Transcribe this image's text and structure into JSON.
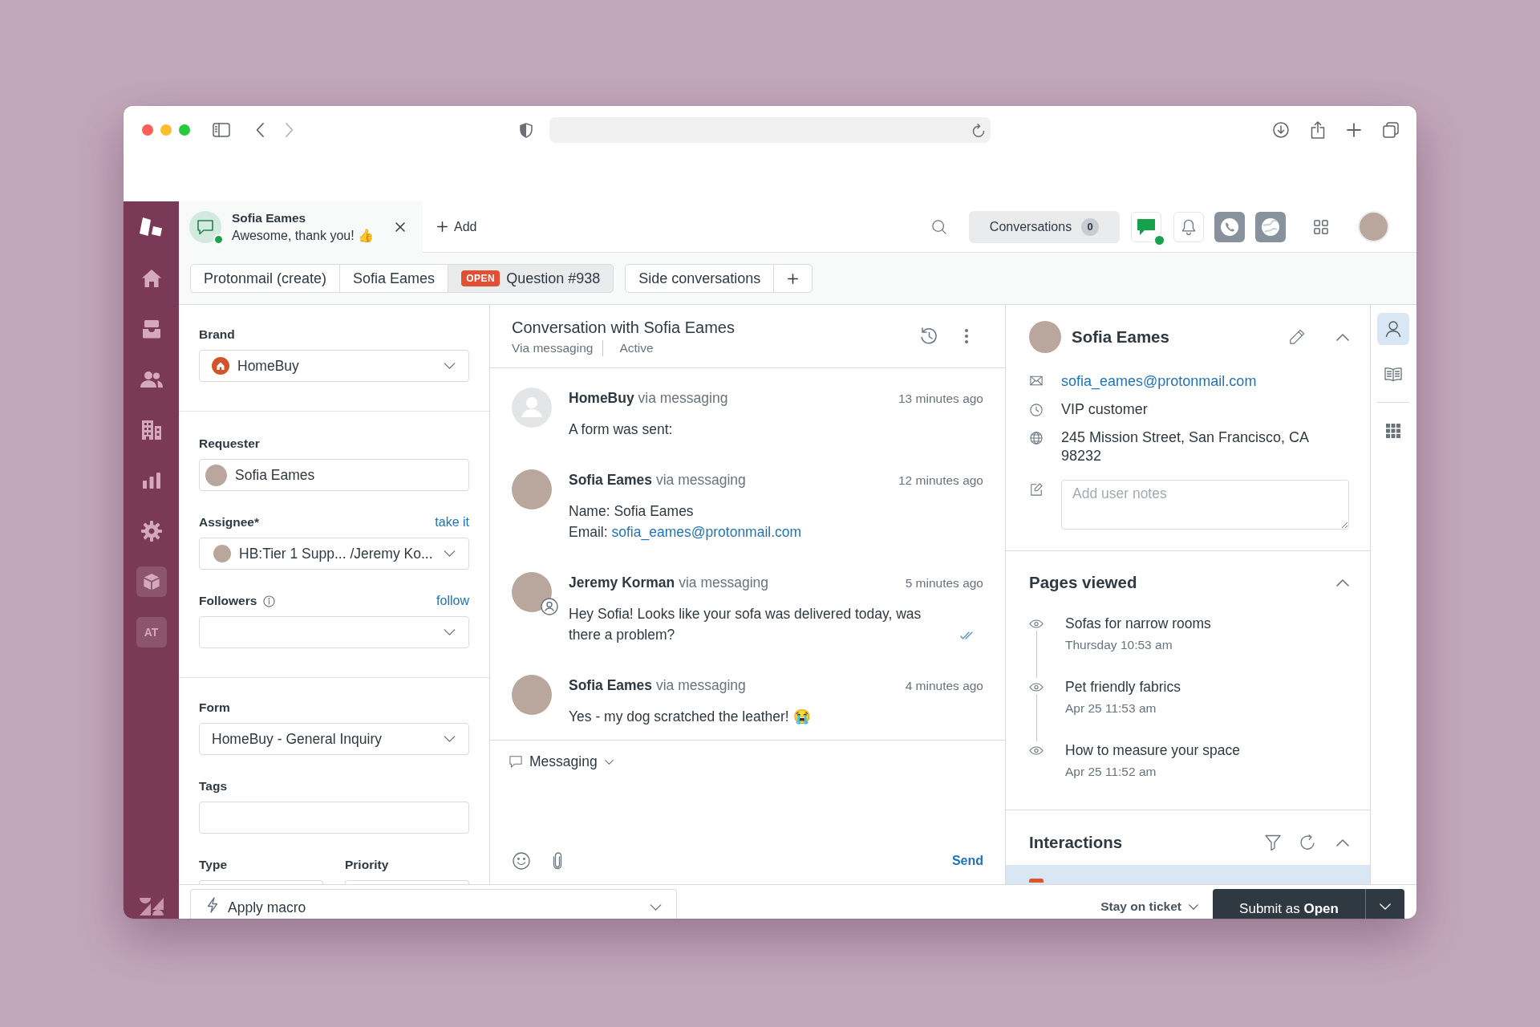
{
  "nav": {
    "items": [
      {
        "kind": "icon"
      },
      {
        "kind": "icon"
      },
      {
        "kind": "icon"
      },
      {
        "kind": "icon"
      },
      {
        "kind": "icon"
      },
      {
        "kind": "icon"
      },
      {
        "kind": "tile"
      },
      {
        "kind": "text",
        "label": "AT"
      }
    ]
  },
  "header": {
    "ticket_tab": {
      "title": "Sofia Eames",
      "preview": "Awesome, thank you! 👍",
      "online": true
    },
    "add_label": "Add",
    "conversations": {
      "label": "Conversations",
      "count": "0"
    },
    "messaging_online": true
  },
  "ticket_tabs": [
    {
      "label": "Protonmail (create)",
      "selected": false
    },
    {
      "label": "Sofia Eames",
      "selected": false
    },
    {
      "label": "Question #938",
      "badge": "OPEN",
      "selected": true
    }
  ],
  "side_tabs": [
    {
      "label": "Side conversations"
    }
  ],
  "ticket_fields": {
    "sections": [
      {
        "rows": [
          {
            "fields": [
              {
                "kind": "select",
                "label": "Brand",
                "logo": true,
                "value": "HomeBuy"
              }
            ]
          }
        ]
      },
      {
        "rows": [
          {
            "fields": [
              {
                "kind": "input",
                "label": "Requester",
                "avatar": true,
                "value": "Sofia Eames"
              }
            ]
          },
          {
            "fields": [
              {
                "kind": "select",
                "label": "Assignee*",
                "link": "take it",
                "avatar": true,
                "value": "HB:Tier 1 Supp... /Jeremy Ko..."
              }
            ]
          },
          {
            "fields": [
              {
                "kind": "select",
                "label": "Followers",
                "info": true,
                "link": "follow"
              }
            ]
          }
        ]
      },
      {
        "rows": [
          {
            "fields": [
              {
                "kind": "select",
                "label": "Form",
                "value": "HomeBuy - General Inquiry"
              }
            ]
          },
          {
            "fields": [
              {
                "kind": "input",
                "label": "Tags"
              }
            ]
          },
          {
            "fields": [
              {
                "kind": "input",
                "label": "Type"
              },
              {
                "kind": "input",
                "label": "Priority"
              }
            ]
          }
        ]
      }
    ]
  },
  "conversation": {
    "title": "Conversation with Sofia Eames",
    "channel": "Via messaging",
    "status": "Active",
    "messages": [
      {
        "kind": "system",
        "from": "**HomeBuy** via messaging",
        "time": "13 minutes ago",
        "read": false,
        "lines": [
          {
            "text": "A form was sent:"
          }
        ]
      },
      {
        "kind": "customer",
        "from": "**Sofia Eames** via messaging",
        "time": "12 minutes ago",
        "read": false,
        "lines": [
          {
            "text": "Name: Sofia Eames"
          },
          {
            "text": "Email:",
            "link": "sofia_eames@protonmail.com"
          }
        ]
      },
      {
        "kind": "agent",
        "from": "**Jeremy Korman** via messaging",
        "time": "5 minutes ago",
        "read": true,
        "lines": [
          {
            "text": "Hey Sofia! Looks like your sofa was delivered today, was there a problem?"
          }
        ]
      },
      {
        "kind": "customer",
        "from": "**Sofia Eames** via messaging",
        "time": "4 minutes ago",
        "read": false,
        "lines": [
          {
            "text": "Yes - my dog scratched the leather! 😭"
          }
        ]
      }
    ]
  },
  "composer": {
    "channel": "Messaging",
    "send": "Send"
  },
  "user": {
    "name": "Sofia Eames",
    "expanded": true,
    "details": [
      {
        "kind": "email",
        "text": "sofia_eames@protonmail.com"
      },
      {
        "kind": "info",
        "text": "VIP customer"
      },
      {
        "kind": "address",
        "text": "245 Mission Street, San Francisco, CA 98232"
      }
    ],
    "notes_placeholder": "Add user notes"
  },
  "pages_viewed": {
    "title": "Pages viewed",
    "expanded": true,
    "items": [
      {
        "title": "Sofas for narrow rooms",
        "time": "Thursday 10:53 am"
      },
      {
        "title": "Pet friendly fabrics",
        "time": "Apr 25 11:53 am"
      },
      {
        "title": "How to measure your space",
        "time": "Apr 25 11:52 am"
      }
    ]
  },
  "interactions": {
    "title": "Interactions",
    "expanded": true,
    "items": [
      {
        "selected": true
      }
    ]
  },
  "rail": {
    "groups": [
      {
        "items": [
          {
            "selected": true
          },
          {
            "selected": false
          }
        ]
      },
      {
        "items": [
          {
            "selected": false
          }
        ]
      }
    ]
  },
  "footer": {
    "macro": "Apply macro",
    "stay": "Stay on ticket",
    "submit": "Submit as **Open**"
  }
}
